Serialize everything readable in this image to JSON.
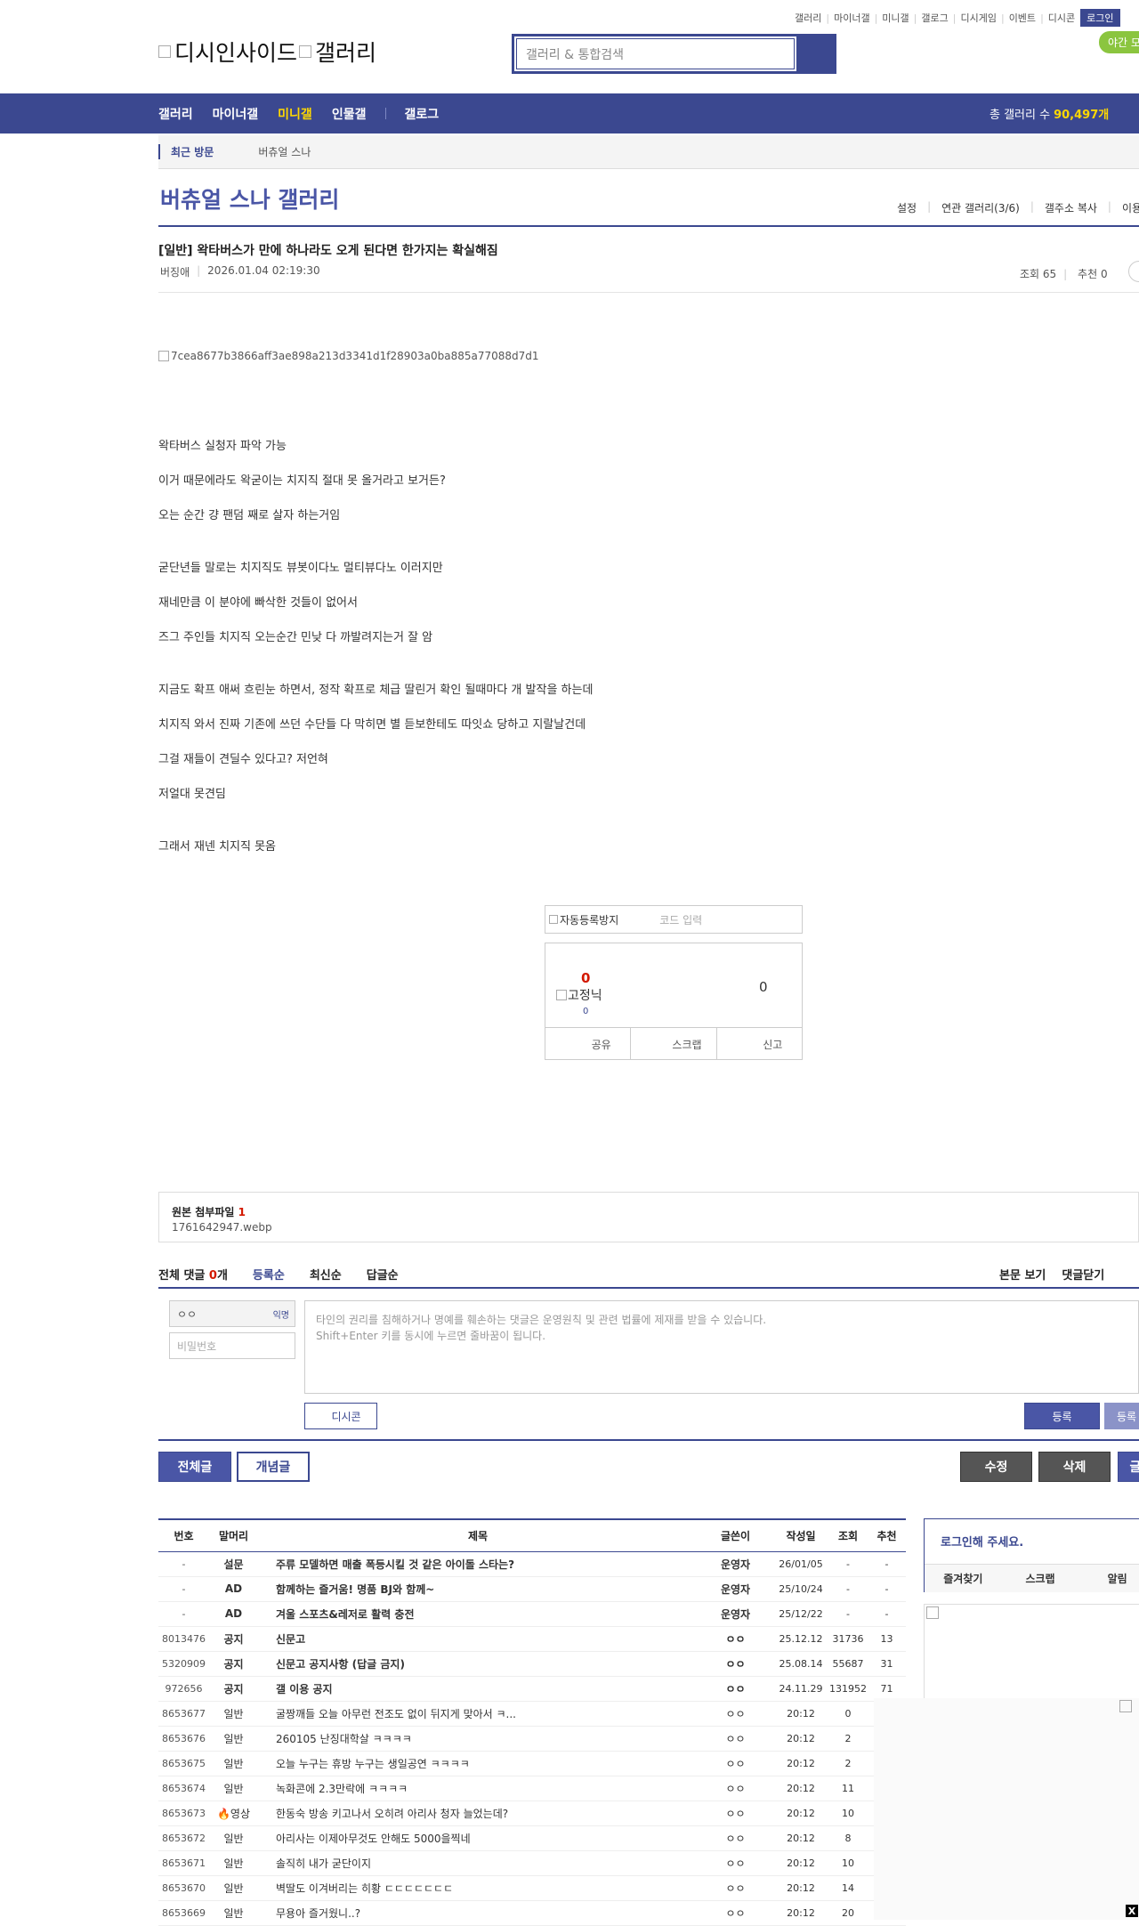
{
  "util_links": [
    "갤러리",
    "마이너갤",
    "미니갤",
    "갤로그",
    "디시게임",
    "이벤트",
    "디시콘"
  ],
  "util_login": "로그인",
  "night_mode": "야간 모드",
  "logo": {
    "alt1": "디시인사이드",
    "alt2": "갤러리"
  },
  "search": {
    "placeholder": "갤러리 & 통합검색"
  },
  "gnb": {
    "items": [
      "갤러리",
      "마이너갤",
      "미니갤",
      "인물갤"
    ],
    "gallog": "갤로그",
    "total_label": "총 갤러리 수",
    "total_value": "90,497개"
  },
  "visit": {
    "label": "최근 방문",
    "gallery": "버츄얼 스나"
  },
  "gallery_title": "버츄얼 스나 갤러리",
  "gallery_menu": [
    "설정",
    "연관 갤러리(3/6)",
    "갤주소 복사",
    "이용"
  ],
  "post": {
    "title": "[일반] 왁타버스가 만에 하나라도 오게 된다면 한가지는 확실해짐",
    "author": "버징애",
    "date": "2026.01.04 02:19:30",
    "views": "조회 65",
    "recommend": "추천 0",
    "image_alt": "7cea8677b3866aff3ae898a213d3341d1f28903a0ba885a77088d7d1",
    "lines": [
      "왁타버스 실청자 파악 가능",
      "이거 때문에라도 왁굳이는 치지직 절대 못 올거라고 보거든?",
      "오는 순간 걍 팬덤 째로 살자 하는거임",
      "굳단년들 말로는 치지직도 뷰봇이다노 멀티뷰다노 이러지만",
      "재네만큼 이 분야에 빠삭한 것들이 없어서",
      "즈그 주인들 치지직 오는순간 민낮 다 까발려지는거 잘 암",
      "지금도 확프 애써 흐린눈 하면서, 정작 확프로 체급 딸린거 확인 될때마다 개 발작을 하는데",
      "치지직 와서 진짜 기존에 쓰던 수단들 다 막히면 별 듣보한테도 따잇쇼 당하고 지랄날건데",
      "그걸 재들이 견딜수 있다고? 저언혀",
      "저얼대 못견딤",
      "그래서 재넨 치지직 못옴"
    ]
  },
  "captcha": {
    "alt": "자동등록방지",
    "placeholder": "코드 입력"
  },
  "recommend_box": {
    "up": "0",
    "fix_alt": "고정닉",
    "fix_count": "0",
    "down": "0",
    "buttons": [
      "공유",
      "스크랩",
      "신고"
    ]
  },
  "attach": {
    "label": "원본 첨부파일",
    "count": "1",
    "file": "1761642947.webp"
  },
  "comments": {
    "label": "전체 댓글",
    "count": "0",
    "unit": "개",
    "sorts": [
      "등록순",
      "최신순",
      "답글순"
    ],
    "right": [
      "본문 보기",
      "댓글닫기"
    ]
  },
  "comment_write": {
    "nick": "ㅇㅇ",
    "anon": "익명",
    "pw_placeholder": "비밀번호",
    "textarea_line1": "타인의 권리를 침해하거나 명예를 훼손하는 댓글은 운영원칙 및 관련 법률에 제재를 받을 수 있습니다.",
    "textarea_line2": "Shift+Enter 키를 동시에 누르면 줄바꿈이 됩니다.",
    "dccon": "디시콘",
    "submit": "등록",
    "submit2": "등록"
  },
  "list_buttons": {
    "all": "전체글",
    "concept": "개념글",
    "edit": "수정",
    "delete": "삭제",
    "write": "글"
  },
  "table": {
    "headers": [
      "번호",
      "말머리",
      "제목",
      "글쓴이",
      "작성일",
      "조회",
      "추천"
    ],
    "rows": [
      {
        "no": "-",
        "head": "설문",
        "title": "주류 모델하면 매출 폭등시킬 것 같은 아이돌 스타는?",
        "writer": "운영자",
        "date": "26/01/05",
        "views": "-",
        "rec": "-",
        "bold": true
      },
      {
        "no": "-",
        "head": "AD",
        "title": "함께하는 즐거움! 명품 BJ와 함께~",
        "writer": "운영자",
        "date": "25/10/24",
        "views": "-",
        "rec": "-",
        "bold": true
      },
      {
        "no": "-",
        "head": "AD",
        "title": "겨울 스포츠&레저로 활력 충전",
        "writer": "운영자",
        "date": "25/12/22",
        "views": "-",
        "rec": "-",
        "bold": true
      },
      {
        "no": "8013476",
        "head": "공지",
        "title": "신문고",
        "writer": "ㅇㅇ",
        "date": "25.12.12",
        "views": "31736",
        "rec": "13",
        "bold": true
      },
      {
        "no": "5320909",
        "head": "공지",
        "title": "신문고 공지사항 (답글 금지)",
        "writer": "ㅇㅇ",
        "date": "25.08.14",
        "views": "55687",
        "rec": "31",
        "bold": true
      },
      {
        "no": "972656",
        "head": "공지",
        "title": "갤 이용 공지",
        "writer": "ㅇㅇ",
        "date": "24.11.29",
        "views": "131952",
        "rec": "71",
        "bold": true
      },
      {
        "no": "8653677",
        "head": "일반",
        "title": "굴짱깨들 오늘 아무런 전조도 없이 뒤지게 맞아서 ㅋ...",
        "writer": "ㅇㅇ",
        "date": "20:12",
        "views": "0",
        "rec": "",
        "bold": false
      },
      {
        "no": "8653676",
        "head": "일반",
        "title": "260105 난징대학살 ㅋㅋㅋㅋ",
        "writer": "ㅇㅇ",
        "date": "20:12",
        "views": "2",
        "rec": "",
        "bold": false
      },
      {
        "no": "8653675",
        "head": "일반",
        "title": "오늘 누구는 휴방 누구는 생일공연 ㅋㅋㅋㅋ",
        "writer": "ㅇㅇ",
        "date": "20:12",
        "views": "2",
        "rec": "",
        "bold": false
      },
      {
        "no": "8653674",
        "head": "일반",
        "title": "녹화콘에 2.3만락에 ㅋㅋㅋㅋ",
        "writer": "ㅇㅇ",
        "date": "20:12",
        "views": "11",
        "rec": "",
        "bold": false
      },
      {
        "no": "8653673",
        "head": "🔥영상",
        "title": "한동숙 방송 키고나서 오히려 아리사 청자 늘었는데?",
        "writer": "ㅇㅇ",
        "date": "20:12",
        "views": "10",
        "rec": "",
        "bold": false
      },
      {
        "no": "8653672",
        "head": "일반",
        "title": "아리사는 이제아무것도 안해도 5000을찍네",
        "writer": "ㅇㅇ",
        "date": "20:12",
        "views": "8",
        "rec": "",
        "bold": false
      },
      {
        "no": "8653671",
        "head": "일반",
        "title": "솔직히 내가 굳단이지",
        "writer": "ㅇㅇ",
        "date": "20:12",
        "views": "10",
        "rec": "",
        "bold": false
      },
      {
        "no": "8653670",
        "head": "일반",
        "title": "벽딸도 이겨버리는 히황 ㄷㄷㄷㄷㄷㄷㄷ",
        "writer": "ㅇㅇ",
        "date": "20:12",
        "views": "14",
        "rec": "",
        "bold": false
      },
      {
        "no": "8653669",
        "head": "일반",
        "title": "무용아 즐거웠니..?",
        "writer": "ㅇㅇ",
        "date": "20:12",
        "views": "20",
        "rec": "",
        "bold": false
      }
    ]
  },
  "login_box": {
    "title": "로그인해 주세요.",
    "menu": [
      "즐겨찾기",
      "스크랩",
      "알림"
    ]
  },
  "close_ad": "X"
}
